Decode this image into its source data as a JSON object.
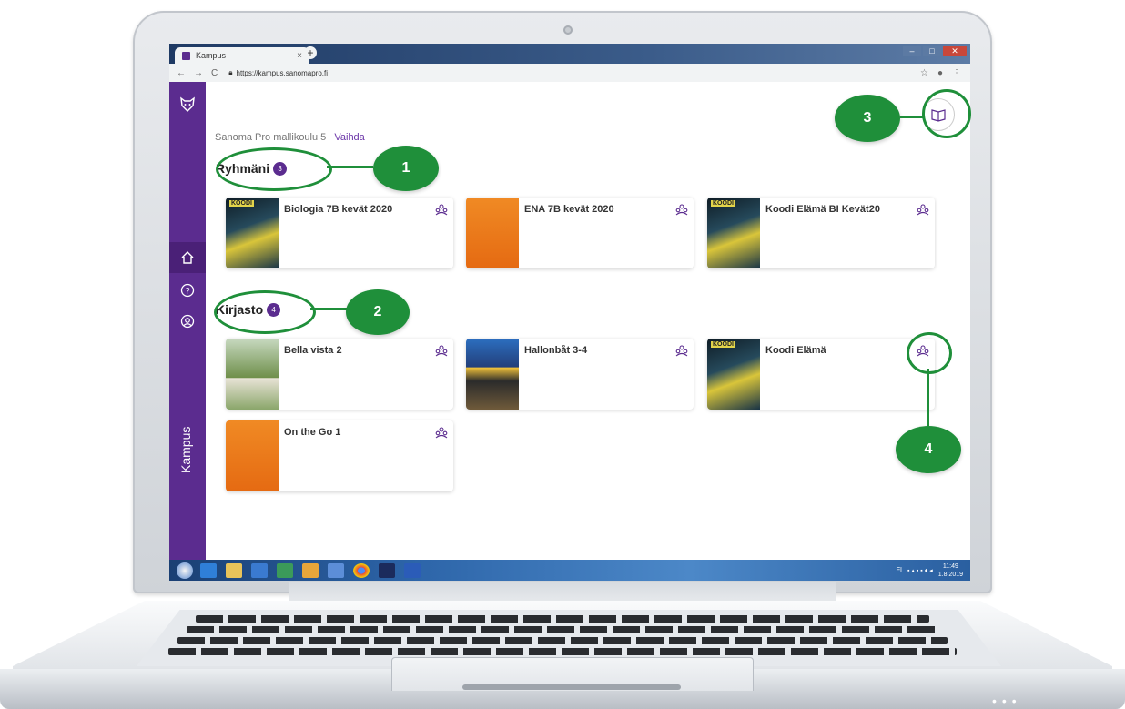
{
  "browser": {
    "tab_title": "Kampus",
    "tab_close": "×",
    "new_tab": "+",
    "url": "https://kampus.sanomapro.fi"
  },
  "app": {
    "school_name": "Sanoma Pro mallikoulu 5",
    "change_school": "Vaihda",
    "brand": "Kampus"
  },
  "groups": {
    "heading": "Ryhmäni",
    "count": "3",
    "items": [
      {
        "title": "Biologia 7B kevät 2020",
        "cover": "koodi"
      },
      {
        "title": "ENA 7B kevät 2020",
        "cover": "go"
      },
      {
        "title": "Koodi Elämä BI Kevät20",
        "cover": "koodi"
      }
    ]
  },
  "library": {
    "heading": "Kirjasto",
    "count": "4",
    "items": [
      {
        "title": "Bella vista 2",
        "cover": "bella"
      },
      {
        "title": "Hallonbåt 3-4",
        "cover": "hallon"
      },
      {
        "title": "Koodi Elämä",
        "cover": "koodi"
      },
      {
        "title": "On the Go 1",
        "cover": "go"
      }
    ]
  },
  "taskbar": {
    "time": "11:49",
    "date": "1.8.2019",
    "lang": "FI"
  },
  "annotations": [
    "1",
    "2",
    "3",
    "4"
  ],
  "colors": {
    "accent": "#5b2c8f",
    "annotation": "#1f8f3a"
  }
}
